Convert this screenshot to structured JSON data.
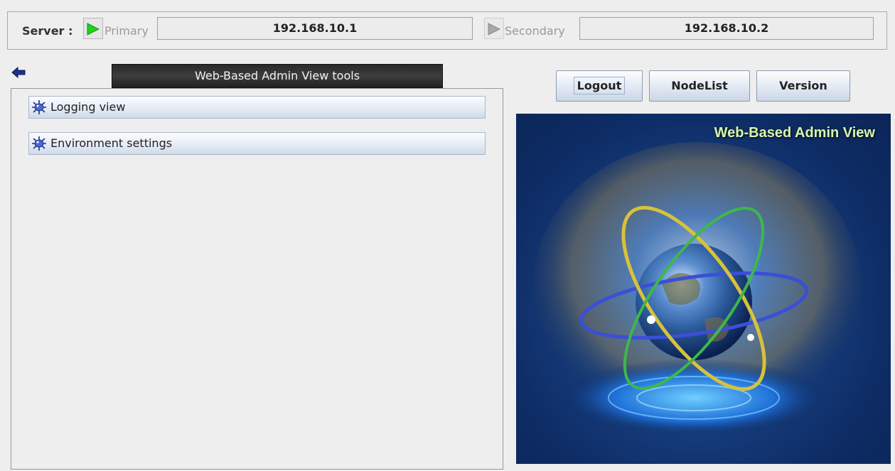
{
  "server_bar": {
    "label": "Server :",
    "primary": {
      "name": "Primary",
      "ip": "192.168.10.1"
    },
    "secondary": {
      "name": "Secondary",
      "ip": "192.168.10.2"
    }
  },
  "tools": {
    "title": "Web-Based Admin View  tools",
    "items": [
      {
        "label": "Logging view",
        "icon": "bug-icon"
      },
      {
        "label": "Environment settings",
        "icon": "bug-icon"
      }
    ]
  },
  "buttons": {
    "logout": "Logout",
    "nodelist": "NodeList",
    "version": "Version"
  },
  "splash": {
    "title": "Web-Based Admin View"
  },
  "colors": {
    "active_server": "#22cc22",
    "inactive_server": "#9a9a9a",
    "title_bar": "#2a2a2a"
  }
}
